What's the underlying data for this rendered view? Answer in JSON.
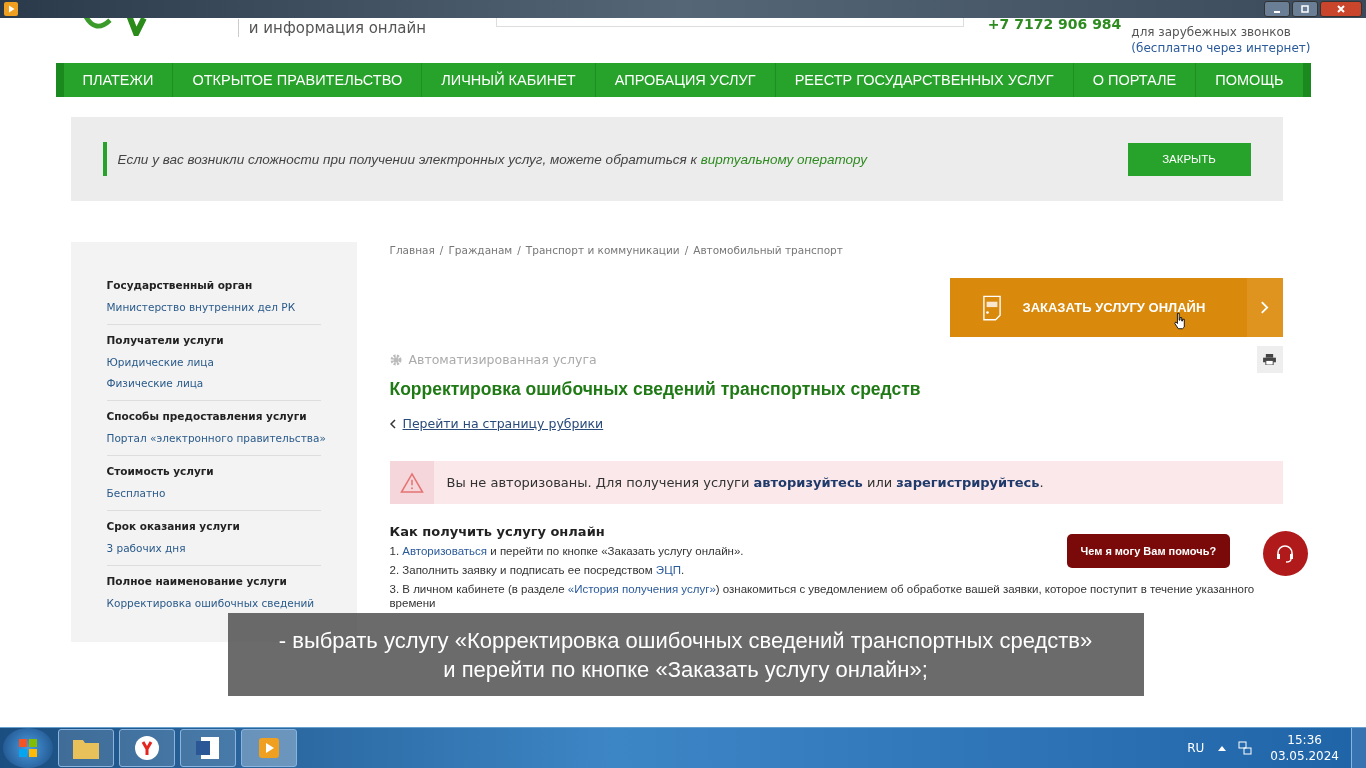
{
  "header": {
    "tagline": "и информация онлайн",
    "phone": "+7 7172 906 984",
    "phone_note": "для зарубежных звонков",
    "phone_note_2": "(бесплатно через интернет)"
  },
  "nav": [
    {
      "label": "ПЛАТЕЖИ"
    },
    {
      "label": "ОТКРЫТОЕ ПРАВИТЕЛЬСТВО"
    },
    {
      "label": "ЛИЧНЫЙ КАБИНЕТ"
    },
    {
      "label": "АПРОБАЦИЯ УСЛУГ"
    },
    {
      "label": "РЕЕСТР ГОСУДАРСТВЕННЫХ УСЛУГ"
    },
    {
      "label": "О ПОРТАЛЕ"
    },
    {
      "label": "ПОМОЩЬ"
    }
  ],
  "notice": {
    "text": "Если у вас возникли сложности при получении электронных услуг, можете обратиться к ",
    "link": "виртуальному оператору",
    "button": "ЗАКРЫТЬ"
  },
  "sidebar": [
    {
      "heading": "Государственный орган",
      "values": [
        "Министерство внутренних дел РК"
      ]
    },
    {
      "heading": "Получатели услуги",
      "values": [
        "Юридические лица",
        "Физические лица"
      ]
    },
    {
      "heading": "Способы предоставления услуги",
      "values": [
        "Портал «электронного правительства»"
      ]
    },
    {
      "heading": "Стоимость услуги",
      "values": [
        "Бесплатно"
      ]
    },
    {
      "heading": "Срок оказания услуги",
      "values": [
        "3 рабочих дня"
      ]
    },
    {
      "heading": "Полное наименование услуги",
      "values": [
        "Корректировка ошибочных сведений"
      ]
    }
  ],
  "breadcrumbs": [
    "Главная",
    "Гражданам",
    "Транспорт и коммуникации",
    "Автомобильный транспорт"
  ],
  "breadcrumb_separator": "/",
  "order_button": "ЗАКАЗАТЬ УСЛУГУ ОНЛАЙН",
  "service_type": "Автоматизированная услуга",
  "title": "Корректировка ошибочных сведений транспортных средств",
  "back_link": "Перейти на страницу рубрики",
  "alert": {
    "text": "Вы не авторизованы. Для получения услуги **авторизуйтесь** или **зарегистрируйтесь**."
  },
  "howto": {
    "heading": "Как получить услугу онлайн",
    "steps": [
      {
        "number": "1.",
        "link": "Авторизоваться",
        "text": " и перейти по кнопке «Заказать услугу онлайн»."
      },
      {
        "number": "2.",
        "text": "Заполнить заявку и подписать ее посредством ",
        "link_end": "ЭЦП",
        "tail": "."
      },
      {
        "number": "3.",
        "text": "В личном кабинете (в разделе ",
        "link_mid": "«История получения услуг»",
        "tail": ") ознакомиться с уведомлением об обработке вашей заявки, которое поступит в течение указанного времени"
      }
    ]
  },
  "chat": {
    "bubble": "Чем я могу Вам помочь?"
  },
  "subtitle": [
    "- выбрать услугу «Корректировка ошибочных сведений транспортных средств»",
    "и перейти по кнопке «Заказать услугу онлайн»;"
  ],
  "taskbar": {
    "language": "RU",
    "time": "15:36",
    "date": "03.05.2024"
  }
}
